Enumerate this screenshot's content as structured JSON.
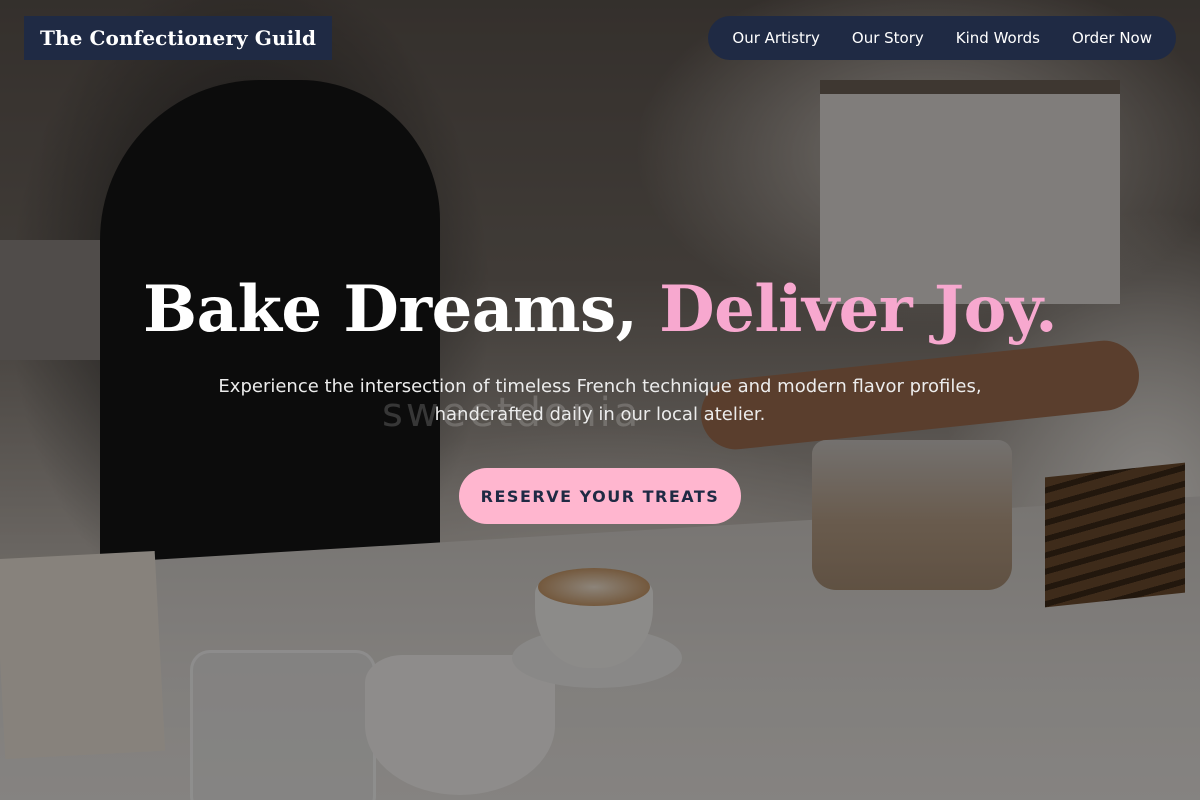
{
  "header": {
    "brand": "The Confectionery Guild",
    "nav": [
      {
        "label": "Our Artistry"
      },
      {
        "label": "Our Story"
      },
      {
        "label": "Kind Words"
      },
      {
        "label": "Order Now"
      }
    ]
  },
  "hero": {
    "headline_part1": "Bake Dreams,",
    "headline_part2": "Deliver Joy.",
    "subtitle_line1": "Experience the intersection of timeless French technique and modern flavor profiles,",
    "subtitle_line2": "handcrafted daily in our local atelier.",
    "watermark": "sweetdonia",
    "cta_label": "RESERVE YOUR TREATS"
  },
  "colors": {
    "navy": "#1f2a44",
    "pink_accent": "#f7a8cf",
    "cta_bg": "#ffb6cf"
  }
}
